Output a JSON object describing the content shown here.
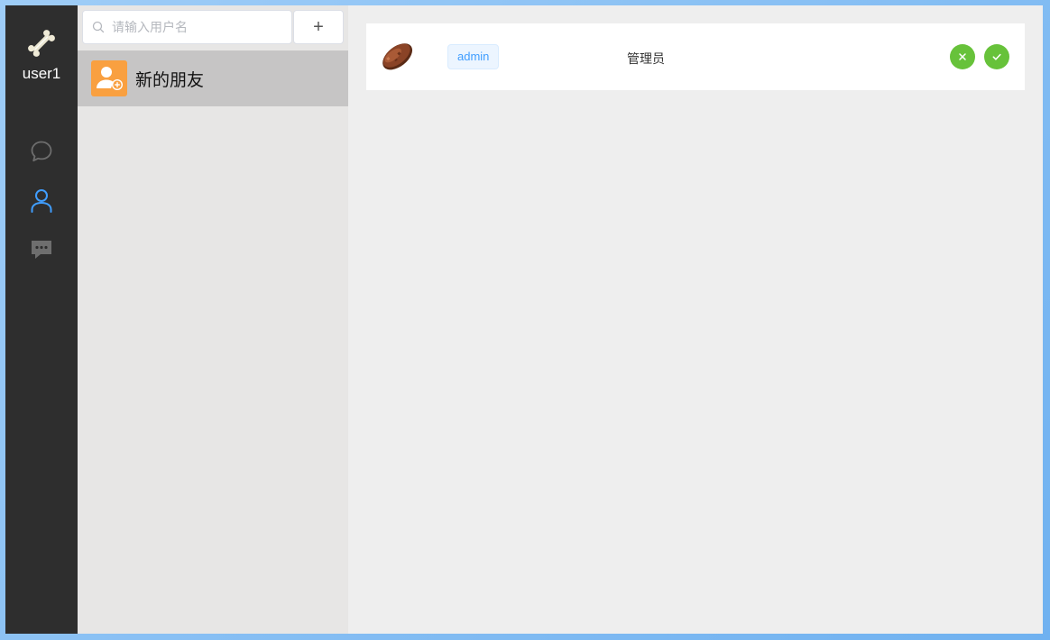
{
  "user": {
    "name": "user1"
  },
  "nav": {
    "items": [
      {
        "id": "chat",
        "icon": "chat-bubble-icon"
      },
      {
        "id": "contacts",
        "icon": "person-icon",
        "active": true
      },
      {
        "id": "messages",
        "icon": "message-dots-icon"
      }
    ]
  },
  "search": {
    "placeholder": "请输入用户名",
    "value": ""
  },
  "add_button": {
    "label": "+"
  },
  "list": {
    "items": [
      {
        "label": "新的朋友",
        "icon": "add-friend-icon",
        "selected": true
      }
    ]
  },
  "requests": [
    {
      "username": "admin",
      "role": "管理员",
      "avatar": "meat-avatar-icon",
      "actions": {
        "reject_icon": "close-icon",
        "accept_icon": "check-icon"
      }
    }
  ],
  "colors": {
    "accent": "#409eff",
    "success": "#67c23a",
    "rail": "#2e2e2e",
    "friend_icon_bg": "#f9a040"
  }
}
